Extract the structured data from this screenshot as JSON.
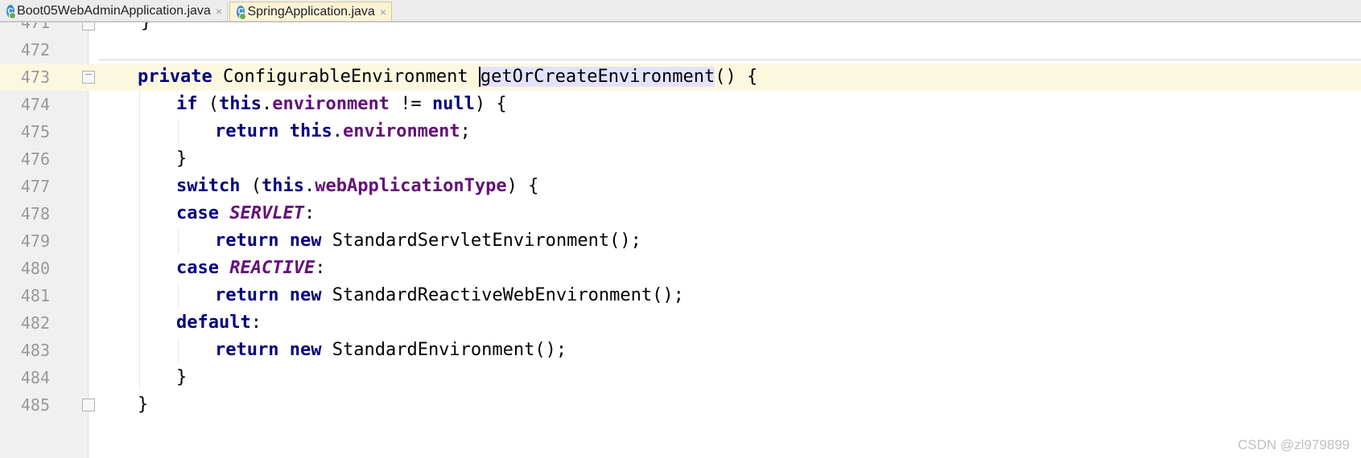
{
  "tabs": [
    {
      "label": "Boot05WebAdminApplication.java",
      "active": false
    },
    {
      "label": "SpringApplication.java",
      "active": true
    }
  ],
  "close_glyph": "×",
  "editor": {
    "current_line": "473",
    "lines": [
      {
        "num": "471",
        "text": "    }"
      },
      {
        "num": "472",
        "text": ""
      },
      {
        "num": "473",
        "text": "private ConfigurableEnvironment getOrCreateEnvironment() {"
      },
      {
        "num": "474",
        "text": "if (this.environment != null) {"
      },
      {
        "num": "475",
        "text": "return this.environment;"
      },
      {
        "num": "476",
        "text": "}"
      },
      {
        "num": "477",
        "text": "switch (this.webApplicationType) {"
      },
      {
        "num": "478",
        "text": "case SERVLET:"
      },
      {
        "num": "479",
        "text": "return new StandardServletEnvironment();"
      },
      {
        "num": "480",
        "text": "case REACTIVE:"
      },
      {
        "num": "481",
        "text": "return new StandardReactiveWebEnvironment();"
      },
      {
        "num": "482",
        "text": "default:"
      },
      {
        "num": "483",
        "text": "return new StandardEnvironment();"
      },
      {
        "num": "484",
        "text": "}"
      },
      {
        "num": "485",
        "text": "}"
      }
    ]
  },
  "tokens": {
    "private": "private",
    "configurable_environment": "ConfigurableEnvironment",
    "method_name": "getOrCreateEnvironment",
    "parens_brace": "() {",
    "if": "if",
    "this": "this",
    "environment": "environment",
    "ne": "!=",
    "null": "null",
    "return": "return",
    "new": "new",
    "switch": "switch",
    "web_application_type": "webApplicationType",
    "case": "case",
    "servlet": "SERVLET",
    "reactive": "REACTIVE",
    "default": "default",
    "standard_servlet_environment": "StandardServletEnvironment();",
    "standard_reactive_web_environment": "StandardReactiveWebEnvironment();",
    "standard_environment": "StandardEnvironment();"
  },
  "watermark": "CSDN @zl979899",
  "colors": {
    "keyword": "#000080",
    "field": "#660e7a",
    "current_line_bg": "#fcf8e0",
    "method_highlight": "#e3e3ff",
    "active_tab_bg": "#fbf3d6"
  }
}
